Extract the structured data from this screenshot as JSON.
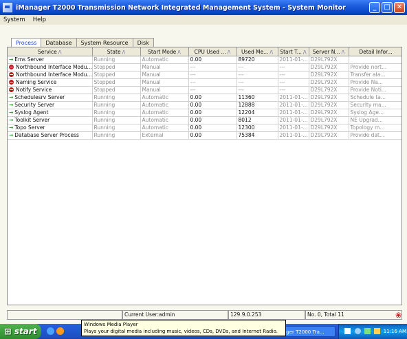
{
  "window": {
    "title": "iManager T2000 Transmission Network Integrated Management System - System Monitor",
    "buttons": [
      "_",
      "□",
      "✕"
    ]
  },
  "menu": [
    "System",
    "Help"
  ],
  "tabs": [
    {
      "label": "Process",
      "active": true
    },
    {
      "label": "Database",
      "active": false
    },
    {
      "label": "System Resource",
      "active": false
    },
    {
      "label": "Disk",
      "active": false
    }
  ],
  "table": {
    "columns": [
      "Service",
      "State",
      "Start Mode",
      "CPU Used ...",
      "Used Me...",
      "Start T...",
      "Server N...",
      "Detail Infor..."
    ],
    "rows": [
      {
        "icon": "run",
        "service": "Ems Server",
        "state": "Running",
        "mode": "Automatic",
        "cpu": "0.00",
        "mem": "89720",
        "start": "2011-01-...",
        "server": "D29L792X",
        "detail": ""
      },
      {
        "icon": "stop",
        "service": "Northbound Interface Modu...",
        "state": "Stopped",
        "mode": "Manual",
        "cpu": "---",
        "mem": "---",
        "start": "---",
        "server": "D29L792X",
        "detail": "Provide nort..."
      },
      {
        "icon": "stop",
        "service": "Northbound Interface Modu...",
        "state": "Stopped",
        "mode": "Manual",
        "cpu": "---",
        "mem": "---",
        "start": "---",
        "server": "D29L792X",
        "detail": "Transfer ala..."
      },
      {
        "icon": "stop",
        "service": "Naming Service",
        "state": "Stopped",
        "mode": "Manual",
        "cpu": "---",
        "mem": "---",
        "start": "---",
        "server": "D29L792X",
        "detail": "Provide Na..."
      },
      {
        "icon": "stop",
        "service": "Notify Service",
        "state": "Stopped",
        "mode": "Manual",
        "cpu": "---",
        "mem": "---",
        "start": "---",
        "server": "D29L792X",
        "detail": "Provide Noti..."
      },
      {
        "icon": "run",
        "service": "Schedulesrv Server",
        "state": "Running",
        "mode": "Automatic",
        "cpu": "0.00",
        "mem": "11360",
        "start": "2011-01-...",
        "server": "D29L792X",
        "detail": "Schedule ta..."
      },
      {
        "icon": "run",
        "service": "Security Server",
        "state": "Running",
        "mode": "Automatic",
        "cpu": "0.00",
        "mem": "12888",
        "start": "2011-01-...",
        "server": "D29L792X",
        "detail": "Security ma..."
      },
      {
        "icon": "run",
        "service": "Syslog Agent",
        "state": "Running",
        "mode": "Automatic",
        "cpu": "0.00",
        "mem": "12204",
        "start": "2011-01-...",
        "server": "D29L792X",
        "detail": "Syslog Age..."
      },
      {
        "icon": "run",
        "service": "Toolkit Server",
        "state": "Running",
        "mode": "Automatic",
        "cpu": "0.00",
        "mem": "8012",
        "start": "2011-01-...",
        "server": "D29L792X",
        "detail": "NE Upgrad..."
      },
      {
        "icon": "run",
        "service": "Topo Server",
        "state": "Running",
        "mode": "Automatic",
        "cpu": "0.00",
        "mem": "12300",
        "start": "2011-01-...",
        "server": "D29L792X",
        "detail": "Topology m..."
      },
      {
        "icon": "run",
        "service": "Database Server Process",
        "state": "Running",
        "mode": "External",
        "cpu": "0.00",
        "mem": "75384",
        "start": "2011-01-...",
        "server": "D29L792X",
        "detail": "Provide dat..."
      }
    ]
  },
  "status": {
    "user": "Current User:admin",
    "ip": "129.9.0.253",
    "count": "No. 0, Total 11"
  },
  "taskbar": {
    "start": "start",
    "task": "ager T2000 Tra...",
    "clock": "11:16 AM"
  },
  "tooltip": {
    "title": "Windows Media Player",
    "text": "Plays your digital media including music, videos, CDs, DVDs, and Internet Radio."
  },
  "colors": {
    "title_blue": "#0a46c9",
    "running": "#1c9a1c",
    "stopped": "#c41818",
    "active_tab": "#1a44c8"
  }
}
